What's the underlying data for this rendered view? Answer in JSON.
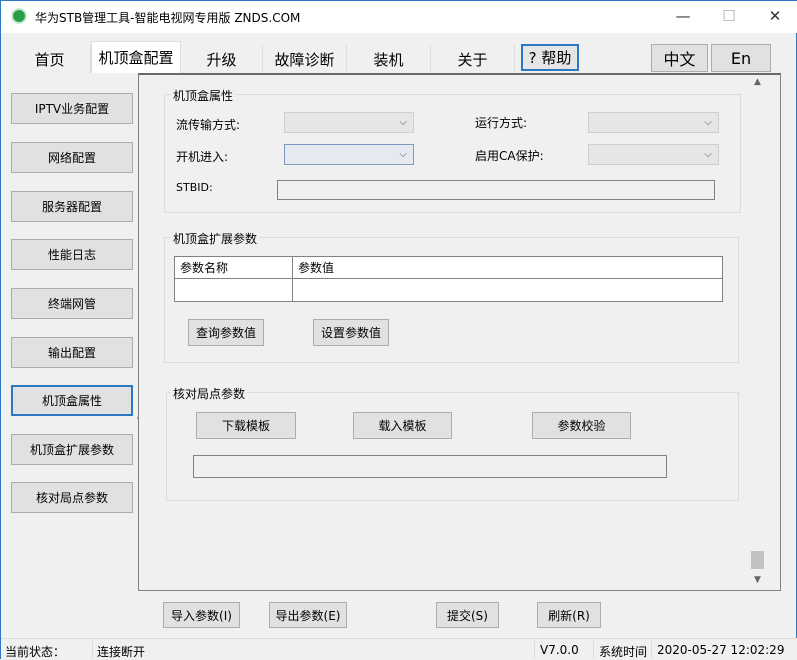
{
  "window": {
    "title": "华为STB管理工具-智能电视网专用版 ZNDS.COM",
    "minimize": "—",
    "maximize": "☐",
    "close": "✕"
  },
  "tabs": [
    "首页",
    "机顶盒配置",
    "升级",
    "故障诊断",
    "装机",
    "关于"
  ],
  "help_label": "? 帮助",
  "lang": {
    "zh": "中文",
    "en": "En"
  },
  "sidebar": [
    "IPTV业务配置",
    "网络配置",
    "服务器配置",
    "性能日志",
    "终端网管",
    "输出配置",
    "机顶盒属性",
    "机顶盒扩展参数",
    "核对局点参数"
  ],
  "stb_props": {
    "title": "机顶盒属性",
    "stream_label": "流传输方式:",
    "run_label": "运行方式:",
    "boot_label": "开机进入:",
    "ca_label": "启用CA保护:",
    "stbid_label": "STBID:",
    "chevron": "⌵"
  },
  "ext_params": {
    "title": "机顶盒扩展参数",
    "col_name": "参数名称",
    "col_value": "参数值",
    "query_btn": "查询参数值",
    "set_btn": "设置参数值"
  },
  "site_params": {
    "title": "核对局点参数",
    "download_btn": "下载模板",
    "load_btn": "载入模板",
    "verify_btn": "参数校验"
  },
  "bottom": {
    "import": "导入参数(I)",
    "export": "导出参数(E)",
    "submit": "提交(S)",
    "refresh": "刷新(R)"
  },
  "statusbar": {
    "state_label": "当前状态：",
    "state_value": "连接断开",
    "version": "V7.0.0",
    "time_label": "系统时间",
    "time_value": "2020-05-27 12:02:29"
  },
  "accent": "#2b79c2"
}
